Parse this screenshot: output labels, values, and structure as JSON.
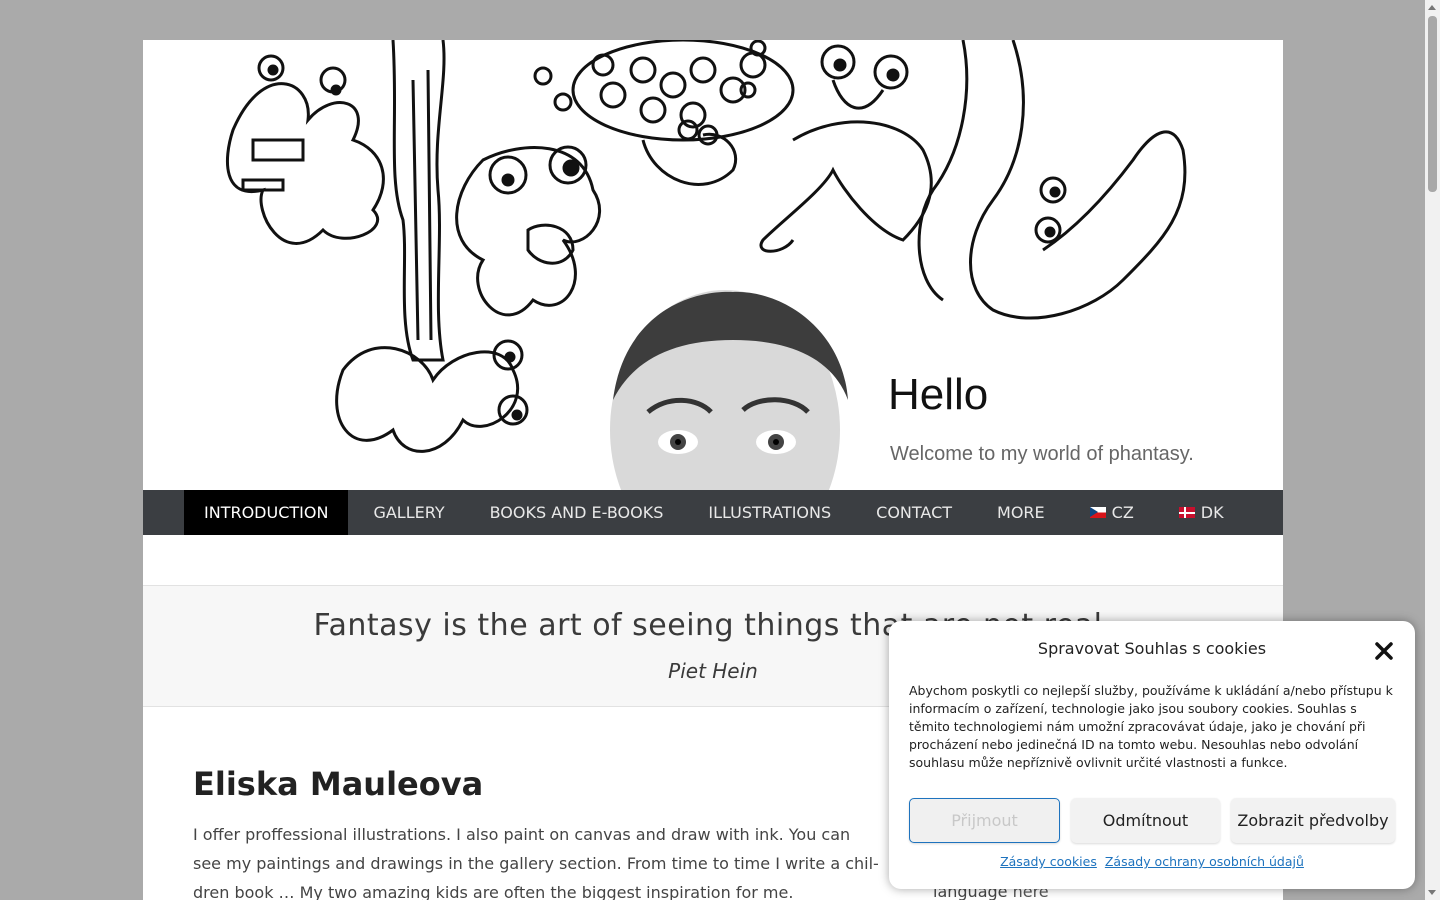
{
  "banner": {
    "hello": "Hello",
    "welcome": "Welcome to my world of phantasy."
  },
  "nav": {
    "items": [
      {
        "label": "INTRODUCTION"
      },
      {
        "label": "GALLERY"
      },
      {
        "label": "BOOKS AND E-BOOKS"
      },
      {
        "label": "ILLUSTRATIONS"
      },
      {
        "label": "CONTACT"
      },
      {
        "label": "MORE"
      },
      {
        "label": "CZ",
        "icon": "czech-flag-icon"
      },
      {
        "label": "DK",
        "icon": "danish-flag-icon"
      }
    ]
  },
  "quote": {
    "text": "Fantasy is the art of seeing things that are not real.",
    "author": "Piet Hein"
  },
  "content": {
    "title": "Eliska Mauleova",
    "body": "I offer proffessional illustrations. I also paint on canvas and draw with ink. You can see my paintings and drawings in the gallery section. From time to time I write a chil-dren book … My two amazing kids are often the biggest inspiration for me."
  },
  "sidebar": {
    "fragment_text": "language ",
    "fragment_link": "here"
  },
  "cookie": {
    "title": "Spravovat Souhlas s cookies",
    "text": "Abychom poskytli co nejlepší služby, používáme k ukládání a/nebo přístupu k informacím o zařízení, technologie jako jsou soubory cookies. Souhlas s těmito technologiemi nám umožní zpracovávat údaje, jako je chování při procházení nebo jedinečná ID na tomto webu. Nesouhlas nebo odvolání souhlasu může nepříznivě ovlivnit určité vlastnosti a funkce.",
    "accept": "Přijmout",
    "deny": "Odmítnout",
    "prefs": "Zobrazit předvolby",
    "link_cookies": "Zásady cookies",
    "link_privacy": "Zásady ochrany osobních údajů"
  },
  "colors": {
    "nav_bg": "#3b3e42",
    "nav_active": "#000000",
    "link_blue": "#1e73be",
    "page_bg": "#aaaaaa"
  }
}
